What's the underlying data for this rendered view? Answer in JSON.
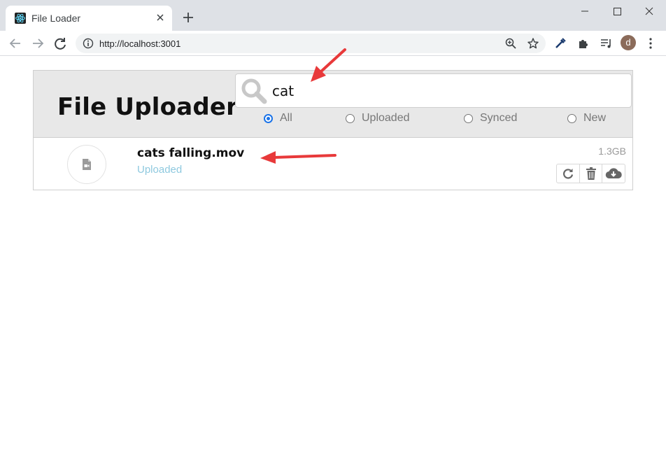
{
  "browser": {
    "tab_title": "File Loader",
    "url": "http://localhost:3001",
    "profile_initial": "d"
  },
  "app": {
    "title": "File Uploader",
    "search": {
      "value": "cat"
    },
    "filters": [
      {
        "label": "All",
        "checked": true
      },
      {
        "label": "Uploaded",
        "checked": false
      },
      {
        "label": "Synced",
        "checked": false
      },
      {
        "label": "New",
        "checked": false
      }
    ],
    "files": [
      {
        "name": "cats falling.mov",
        "status": "Uploaded",
        "size": "1.3GB"
      }
    ]
  },
  "colors": {
    "status_uploaded": "#8ec9df",
    "annotation_arrow": "#e8393a",
    "radio_accent": "#1a73e8"
  }
}
